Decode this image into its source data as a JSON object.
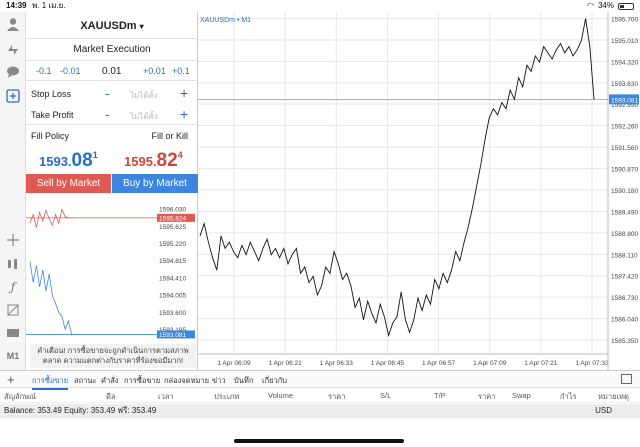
{
  "status": {
    "time": "14:39",
    "date": "พ. 1 เม.ย.",
    "battery": "34%",
    "battery_level": 0.34
  },
  "left_toolbar": {
    "icons": [
      "account-icon",
      "quotes-icon",
      "chat-icon",
      "new-order-icon",
      "crosshair-icon",
      "indicators-icon",
      "function-icon",
      "objects-icon",
      "templates-icon",
      "timeframe-icon"
    ],
    "timeframe_label": "M1"
  },
  "order": {
    "symbol": "XAUUSDm",
    "symbol_caret": "▾",
    "execution": "Market Execution",
    "steps": [
      "-0.1",
      "-0.01",
      "0.01",
      "+0.01",
      "+0.1"
    ],
    "stop_loss_label": "Stop Loss",
    "stop_loss_placeholder": "ไม่ได้ตั้ง",
    "take_profit_label": "Take Profit",
    "take_profit_placeholder": "ไม่ได้ตั้ง",
    "minus": "-",
    "plus": "+",
    "fill_policy_label": "Fill Policy",
    "fill_policy_value": "Fill or Kill",
    "bid_small": "1593.",
    "bid_big": "08",
    "bid_sup": "1",
    "ask_small": "1595.",
    "ask_big": "82",
    "ask_sup": "4",
    "sell_label": "Sell by Market",
    "buy_label": "Buy by Market",
    "warning": "คำเตือน! การซื้อขายจะถูกดำเนินการตามสภาพตลาด ความแตกต่างกับราคาที่ร้องขอมีมาก!"
  },
  "mini_chart": {
    "ticks": [
      "1596.030",
      "1595.824",
      "1595.625",
      "1595.220",
      "1594.815",
      "1594.410",
      "1594.005",
      "1593.600",
      "1593.195",
      "1593.081"
    ],
    "ask_line": 1595.824,
    "bid_line": 1593.081,
    "ask_ticks": [
      1595.7,
      1595.9,
      1595.6,
      1595.95,
      1595.75,
      1596.0,
      1595.8,
      1595.65,
      1595.9,
      1595.7,
      1596.02,
      1595.85,
      1595.824,
      1595.824,
      1595.824
    ],
    "bid_ticks": [
      1594.8,
      1594.3,
      1594.7,
      1594.2,
      1594.6,
      1594.1,
      1594.5,
      1594.0,
      1593.8,
      1593.6,
      1593.5,
      1593.2,
      1593.4,
      1593.081,
      1593.081,
      1593.081
    ]
  },
  "chart": {
    "title": "XAUUSDm • M1",
    "current_price_label": "1593.081",
    "colors": {
      "line": "#111111",
      "grid": "#e6e6e6",
      "price_tag": "#3d86df",
      "ask": "#df5a52"
    }
  },
  "chart_data": {
    "type": "line",
    "title": "XAUUSDm • M1",
    "ylim": [
      1584.9,
      1595.72
    ],
    "y_ticks": [
      "1595.700",
      "1595.010",
      "1594.320",
      "1593.630",
      "1592.950",
      "1592.260",
      "1591.560",
      "1590.870",
      "1590.180",
      "1589.490",
      "1588.800",
      "1588.110",
      "1587.420",
      "1586.730",
      "1586.040",
      "1585.350"
    ],
    "x_ticks": [
      "1 Apr 06:09",
      "1 Apr 06:21",
      "1 Apr 06:33",
      "1 Apr 06:45",
      "1 Apr 06:57",
      "1 Apr 07:09",
      "1 Apr 07:21",
      "1 Apr 07:33"
    ],
    "values": [
      1588.7,
      1589.1,
      1588.5,
      1588.0,
      1587.6,
      1588.7,
      1588.3,
      1588.5,
      1588.2,
      1588.0,
      1588.4,
      1588.1,
      1588.5,
      1588.2,
      1587.9,
      1588.3,
      1588.6,
      1588.1,
      1588.3,
      1588.0,
      1588.3,
      1587.8,
      1588.1,
      1588.3,
      1587.5,
      1587.7,
      1587.2,
      1587.4,
      1586.8,
      1587.1,
      1587.7,
      1587.5,
      1588.2,
      1587.8,
      1587.3,
      1587.5,
      1587.1,
      1586.4,
      1586.7,
      1586.0,
      1586.6,
      1586.2,
      1585.9,
      1586.5,
      1586.1,
      1585.5,
      1585.9,
      1586.1,
      1586.9,
      1586.0,
      1585.6,
      1586.0,
      1586.7,
      1586.3,
      1586.8,
      1586.5,
      1587.3,
      1587.0,
      1587.5,
      1587.2,
      1587.6,
      1588.2,
      1587.9,
      1588.5,
      1589.0,
      1589.6,
      1590.3,
      1591.0,
      1591.8,
      1592.5,
      1592.8,
      1592.6,
      1593.0,
      1592.8,
      1593.4,
      1593.1,
      1593.8,
      1593.5,
      1594.2,
      1594.0,
      1594.5,
      1594.3,
      1594.8,
      1594.6,
      1594.4,
      1594.7,
      1594.9,
      1594.6,
      1594.8,
      1594.5,
      1594.7,
      1595.0,
      1595.7,
      1594.8,
      1593.1
    ]
  },
  "bottom": {
    "plus": "+",
    "tabs": [
      "การซื้อขาย",
      "สถานะ",
      "คำสั่ง",
      "การซื้อขาย",
      "กล่องจดหมาย",
      "ข่าว",
      "บันทึก",
      "เกี่ยวกับ"
    ],
    "columns": [
      "สัญลักษณ์",
      "ดีล",
      "เวลา",
      "ประเภท",
      "Volume",
      "ราคา",
      "S/L",
      "T/P",
      "ราคา",
      "Swap",
      "กำไร",
      "หมายเหตุ"
    ],
    "balance": "Balance: 353.49 Equity: 353.49 ฟรี: 353.49",
    "currency": "USD"
  }
}
